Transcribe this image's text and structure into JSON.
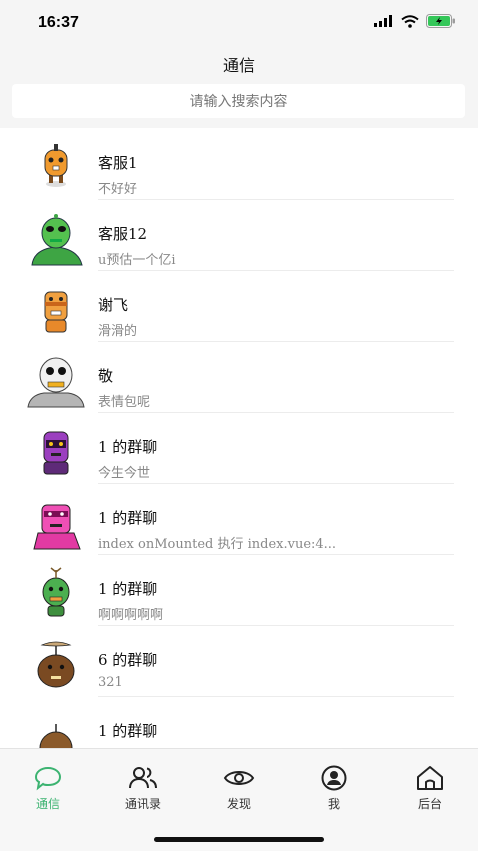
{
  "status_bar": {
    "time": "16:37"
  },
  "header": {
    "title": "通信"
  },
  "search": {
    "placeholder": "请输入搜索内容"
  },
  "chats": [
    {
      "name": "客服1",
      "preview": "不好好",
      "avatar": "orange-robot"
    },
    {
      "name": "客服12",
      "preview": "u预估一个亿i",
      "avatar": "green-alien"
    },
    {
      "name": "谢飞",
      "preview": "滑滑的",
      "avatar": "orange-cartoon"
    },
    {
      "name": "敬",
      "preview": "表情包呢",
      "avatar": "white-robot"
    },
    {
      "name": "1 的群聊",
      "preview": "今生今世",
      "avatar": "purple-robot"
    },
    {
      "name": "1 的群聊",
      "preview": "index onMounted 执行 index.vue:4...",
      "avatar": "pink-robot"
    },
    {
      "name": "1 的群聊",
      "preview": "啊啊啊啊啊",
      "avatar": "green-sprout"
    },
    {
      "name": "6 的群聊",
      "preview": "321",
      "avatar": "brown-propeller"
    },
    {
      "name": "1 的群聊",
      "preview": "",
      "avatar": "brown-cartoon"
    }
  ],
  "tabs": [
    {
      "label": "通信",
      "icon": "chat-bubble-icon",
      "active": true
    },
    {
      "label": "通讯录",
      "icon": "contacts-icon",
      "active": false
    },
    {
      "label": "发现",
      "icon": "eye-icon",
      "active": false
    },
    {
      "label": "我",
      "icon": "user-icon",
      "active": false
    },
    {
      "label": "后台",
      "icon": "home-icon",
      "active": false
    }
  ],
  "colors": {
    "accent": "#3cb371",
    "background": "#f5f5f5"
  }
}
